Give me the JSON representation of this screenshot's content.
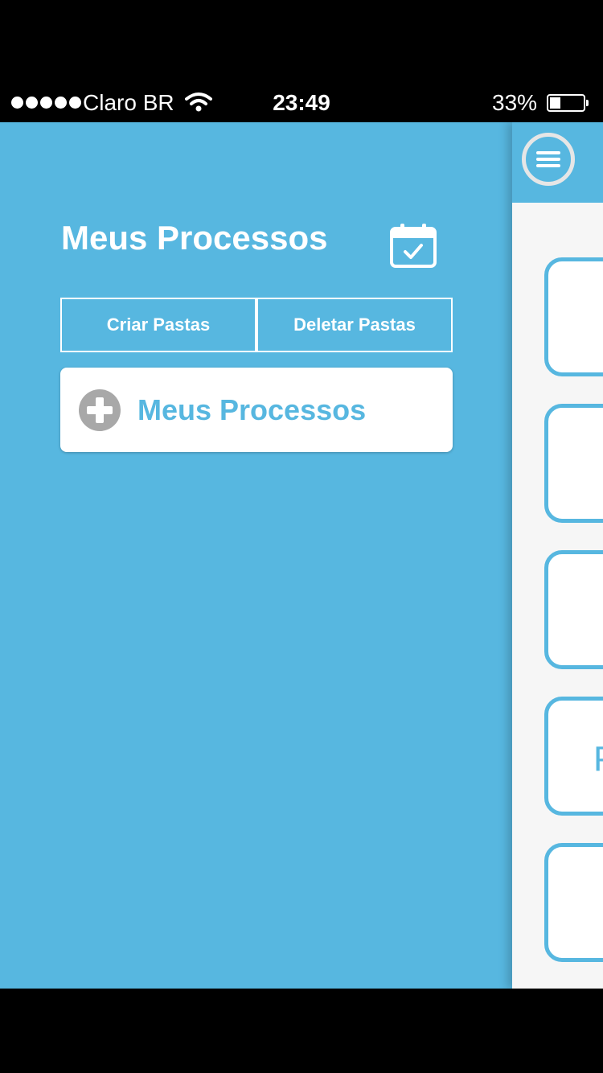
{
  "status_bar": {
    "carrier": "Claro BR",
    "time": "23:49",
    "battery_percent_label": "33%",
    "battery_level": 0.33,
    "signal_bars": 5
  },
  "drawer": {
    "title": "Meus Processos",
    "buttons": {
      "create": "Criar Pastas",
      "delete": "Deletar Pastas"
    },
    "folders": [
      {
        "label": "Meus Processos"
      }
    ]
  },
  "main": {
    "cards": [
      {
        "text": ""
      },
      {
        "text": ""
      },
      {
        "text": ""
      },
      {
        "text": "P"
      },
      {
        "text": ""
      }
    ]
  },
  "colors": {
    "accent": "#57b7e0",
    "panel_background": "#f6f6f6",
    "icon_gray": "#a8a8a8"
  }
}
